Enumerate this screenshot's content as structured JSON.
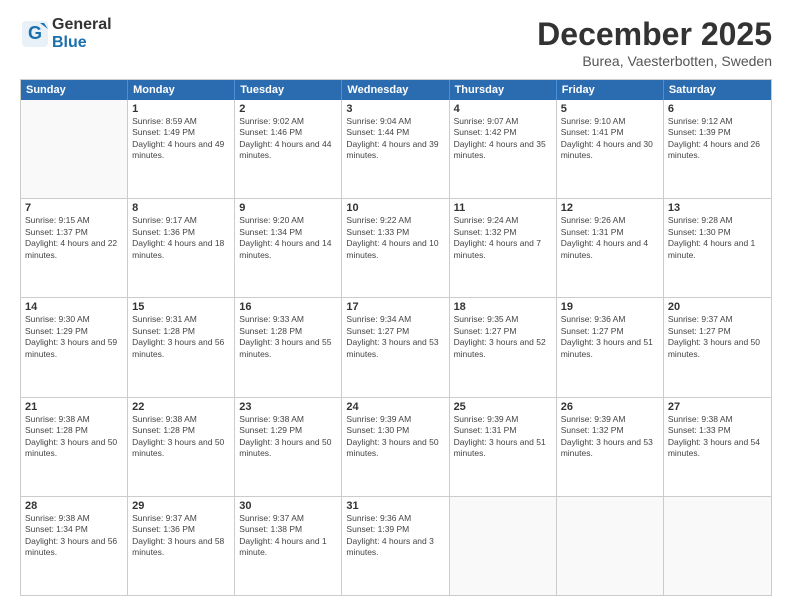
{
  "logo": {
    "general": "General",
    "blue": "Blue"
  },
  "title": "December 2025",
  "subtitle": "Burea, Vaesterbotten, Sweden",
  "header_days": [
    "Sunday",
    "Monday",
    "Tuesday",
    "Wednesday",
    "Thursday",
    "Friday",
    "Saturday"
  ],
  "weeks": [
    [
      {
        "day": "",
        "empty": true
      },
      {
        "day": "1",
        "sunrise": "Sunrise: 8:59 AM",
        "sunset": "Sunset: 1:49 PM",
        "daylight": "Daylight: 4 hours and 49 minutes."
      },
      {
        "day": "2",
        "sunrise": "Sunrise: 9:02 AM",
        "sunset": "Sunset: 1:46 PM",
        "daylight": "Daylight: 4 hours and 44 minutes."
      },
      {
        "day": "3",
        "sunrise": "Sunrise: 9:04 AM",
        "sunset": "Sunset: 1:44 PM",
        "daylight": "Daylight: 4 hours and 39 minutes."
      },
      {
        "day": "4",
        "sunrise": "Sunrise: 9:07 AM",
        "sunset": "Sunset: 1:42 PM",
        "daylight": "Daylight: 4 hours and 35 minutes."
      },
      {
        "day": "5",
        "sunrise": "Sunrise: 9:10 AM",
        "sunset": "Sunset: 1:41 PM",
        "daylight": "Daylight: 4 hours and 30 minutes."
      },
      {
        "day": "6",
        "sunrise": "Sunrise: 9:12 AM",
        "sunset": "Sunset: 1:39 PM",
        "daylight": "Daylight: 4 hours and 26 minutes."
      }
    ],
    [
      {
        "day": "7",
        "sunrise": "Sunrise: 9:15 AM",
        "sunset": "Sunset: 1:37 PM",
        "daylight": "Daylight: 4 hours and 22 minutes."
      },
      {
        "day": "8",
        "sunrise": "Sunrise: 9:17 AM",
        "sunset": "Sunset: 1:36 PM",
        "daylight": "Daylight: 4 hours and 18 minutes."
      },
      {
        "day": "9",
        "sunrise": "Sunrise: 9:20 AM",
        "sunset": "Sunset: 1:34 PM",
        "daylight": "Daylight: 4 hours and 14 minutes."
      },
      {
        "day": "10",
        "sunrise": "Sunrise: 9:22 AM",
        "sunset": "Sunset: 1:33 PM",
        "daylight": "Daylight: 4 hours and 10 minutes."
      },
      {
        "day": "11",
        "sunrise": "Sunrise: 9:24 AM",
        "sunset": "Sunset: 1:32 PM",
        "daylight": "Daylight: 4 hours and 7 minutes."
      },
      {
        "day": "12",
        "sunrise": "Sunrise: 9:26 AM",
        "sunset": "Sunset: 1:31 PM",
        "daylight": "Daylight: 4 hours and 4 minutes."
      },
      {
        "day": "13",
        "sunrise": "Sunrise: 9:28 AM",
        "sunset": "Sunset: 1:30 PM",
        "daylight": "Daylight: 4 hours and 1 minute."
      }
    ],
    [
      {
        "day": "14",
        "sunrise": "Sunrise: 9:30 AM",
        "sunset": "Sunset: 1:29 PM",
        "daylight": "Daylight: 3 hours and 59 minutes."
      },
      {
        "day": "15",
        "sunrise": "Sunrise: 9:31 AM",
        "sunset": "Sunset: 1:28 PM",
        "daylight": "Daylight: 3 hours and 56 minutes."
      },
      {
        "day": "16",
        "sunrise": "Sunrise: 9:33 AM",
        "sunset": "Sunset: 1:28 PM",
        "daylight": "Daylight: 3 hours and 55 minutes."
      },
      {
        "day": "17",
        "sunrise": "Sunrise: 9:34 AM",
        "sunset": "Sunset: 1:27 PM",
        "daylight": "Daylight: 3 hours and 53 minutes."
      },
      {
        "day": "18",
        "sunrise": "Sunrise: 9:35 AM",
        "sunset": "Sunset: 1:27 PM",
        "daylight": "Daylight: 3 hours and 52 minutes."
      },
      {
        "day": "19",
        "sunrise": "Sunrise: 9:36 AM",
        "sunset": "Sunset: 1:27 PM",
        "daylight": "Daylight: 3 hours and 51 minutes."
      },
      {
        "day": "20",
        "sunrise": "Sunrise: 9:37 AM",
        "sunset": "Sunset: 1:27 PM",
        "daylight": "Daylight: 3 hours and 50 minutes."
      }
    ],
    [
      {
        "day": "21",
        "sunrise": "Sunrise: 9:38 AM",
        "sunset": "Sunset: 1:28 PM",
        "daylight": "Daylight: 3 hours and 50 minutes."
      },
      {
        "day": "22",
        "sunrise": "Sunrise: 9:38 AM",
        "sunset": "Sunset: 1:28 PM",
        "daylight": "Daylight: 3 hours and 50 minutes."
      },
      {
        "day": "23",
        "sunrise": "Sunrise: 9:38 AM",
        "sunset": "Sunset: 1:29 PM",
        "daylight": "Daylight: 3 hours and 50 minutes."
      },
      {
        "day": "24",
        "sunrise": "Sunrise: 9:39 AM",
        "sunset": "Sunset: 1:30 PM",
        "daylight": "Daylight: 3 hours and 50 minutes."
      },
      {
        "day": "25",
        "sunrise": "Sunrise: 9:39 AM",
        "sunset": "Sunset: 1:31 PM",
        "daylight": "Daylight: 3 hours and 51 minutes."
      },
      {
        "day": "26",
        "sunrise": "Sunrise: 9:39 AM",
        "sunset": "Sunset: 1:32 PM",
        "daylight": "Daylight: 3 hours and 53 minutes."
      },
      {
        "day": "27",
        "sunrise": "Sunrise: 9:38 AM",
        "sunset": "Sunset: 1:33 PM",
        "daylight": "Daylight: 3 hours and 54 minutes."
      }
    ],
    [
      {
        "day": "28",
        "sunrise": "Sunrise: 9:38 AM",
        "sunset": "Sunset: 1:34 PM",
        "daylight": "Daylight: 3 hours and 56 minutes."
      },
      {
        "day": "29",
        "sunrise": "Sunrise: 9:37 AM",
        "sunset": "Sunset: 1:36 PM",
        "daylight": "Daylight: 3 hours and 58 minutes."
      },
      {
        "day": "30",
        "sunrise": "Sunrise: 9:37 AM",
        "sunset": "Sunset: 1:38 PM",
        "daylight": "Daylight: 4 hours and 1 minute."
      },
      {
        "day": "31",
        "sunrise": "Sunrise: 9:36 AM",
        "sunset": "Sunset: 1:39 PM",
        "daylight": "Daylight: 4 hours and 3 minutes."
      },
      {
        "day": "",
        "empty": true
      },
      {
        "day": "",
        "empty": true
      },
      {
        "day": "",
        "empty": true
      }
    ]
  ]
}
